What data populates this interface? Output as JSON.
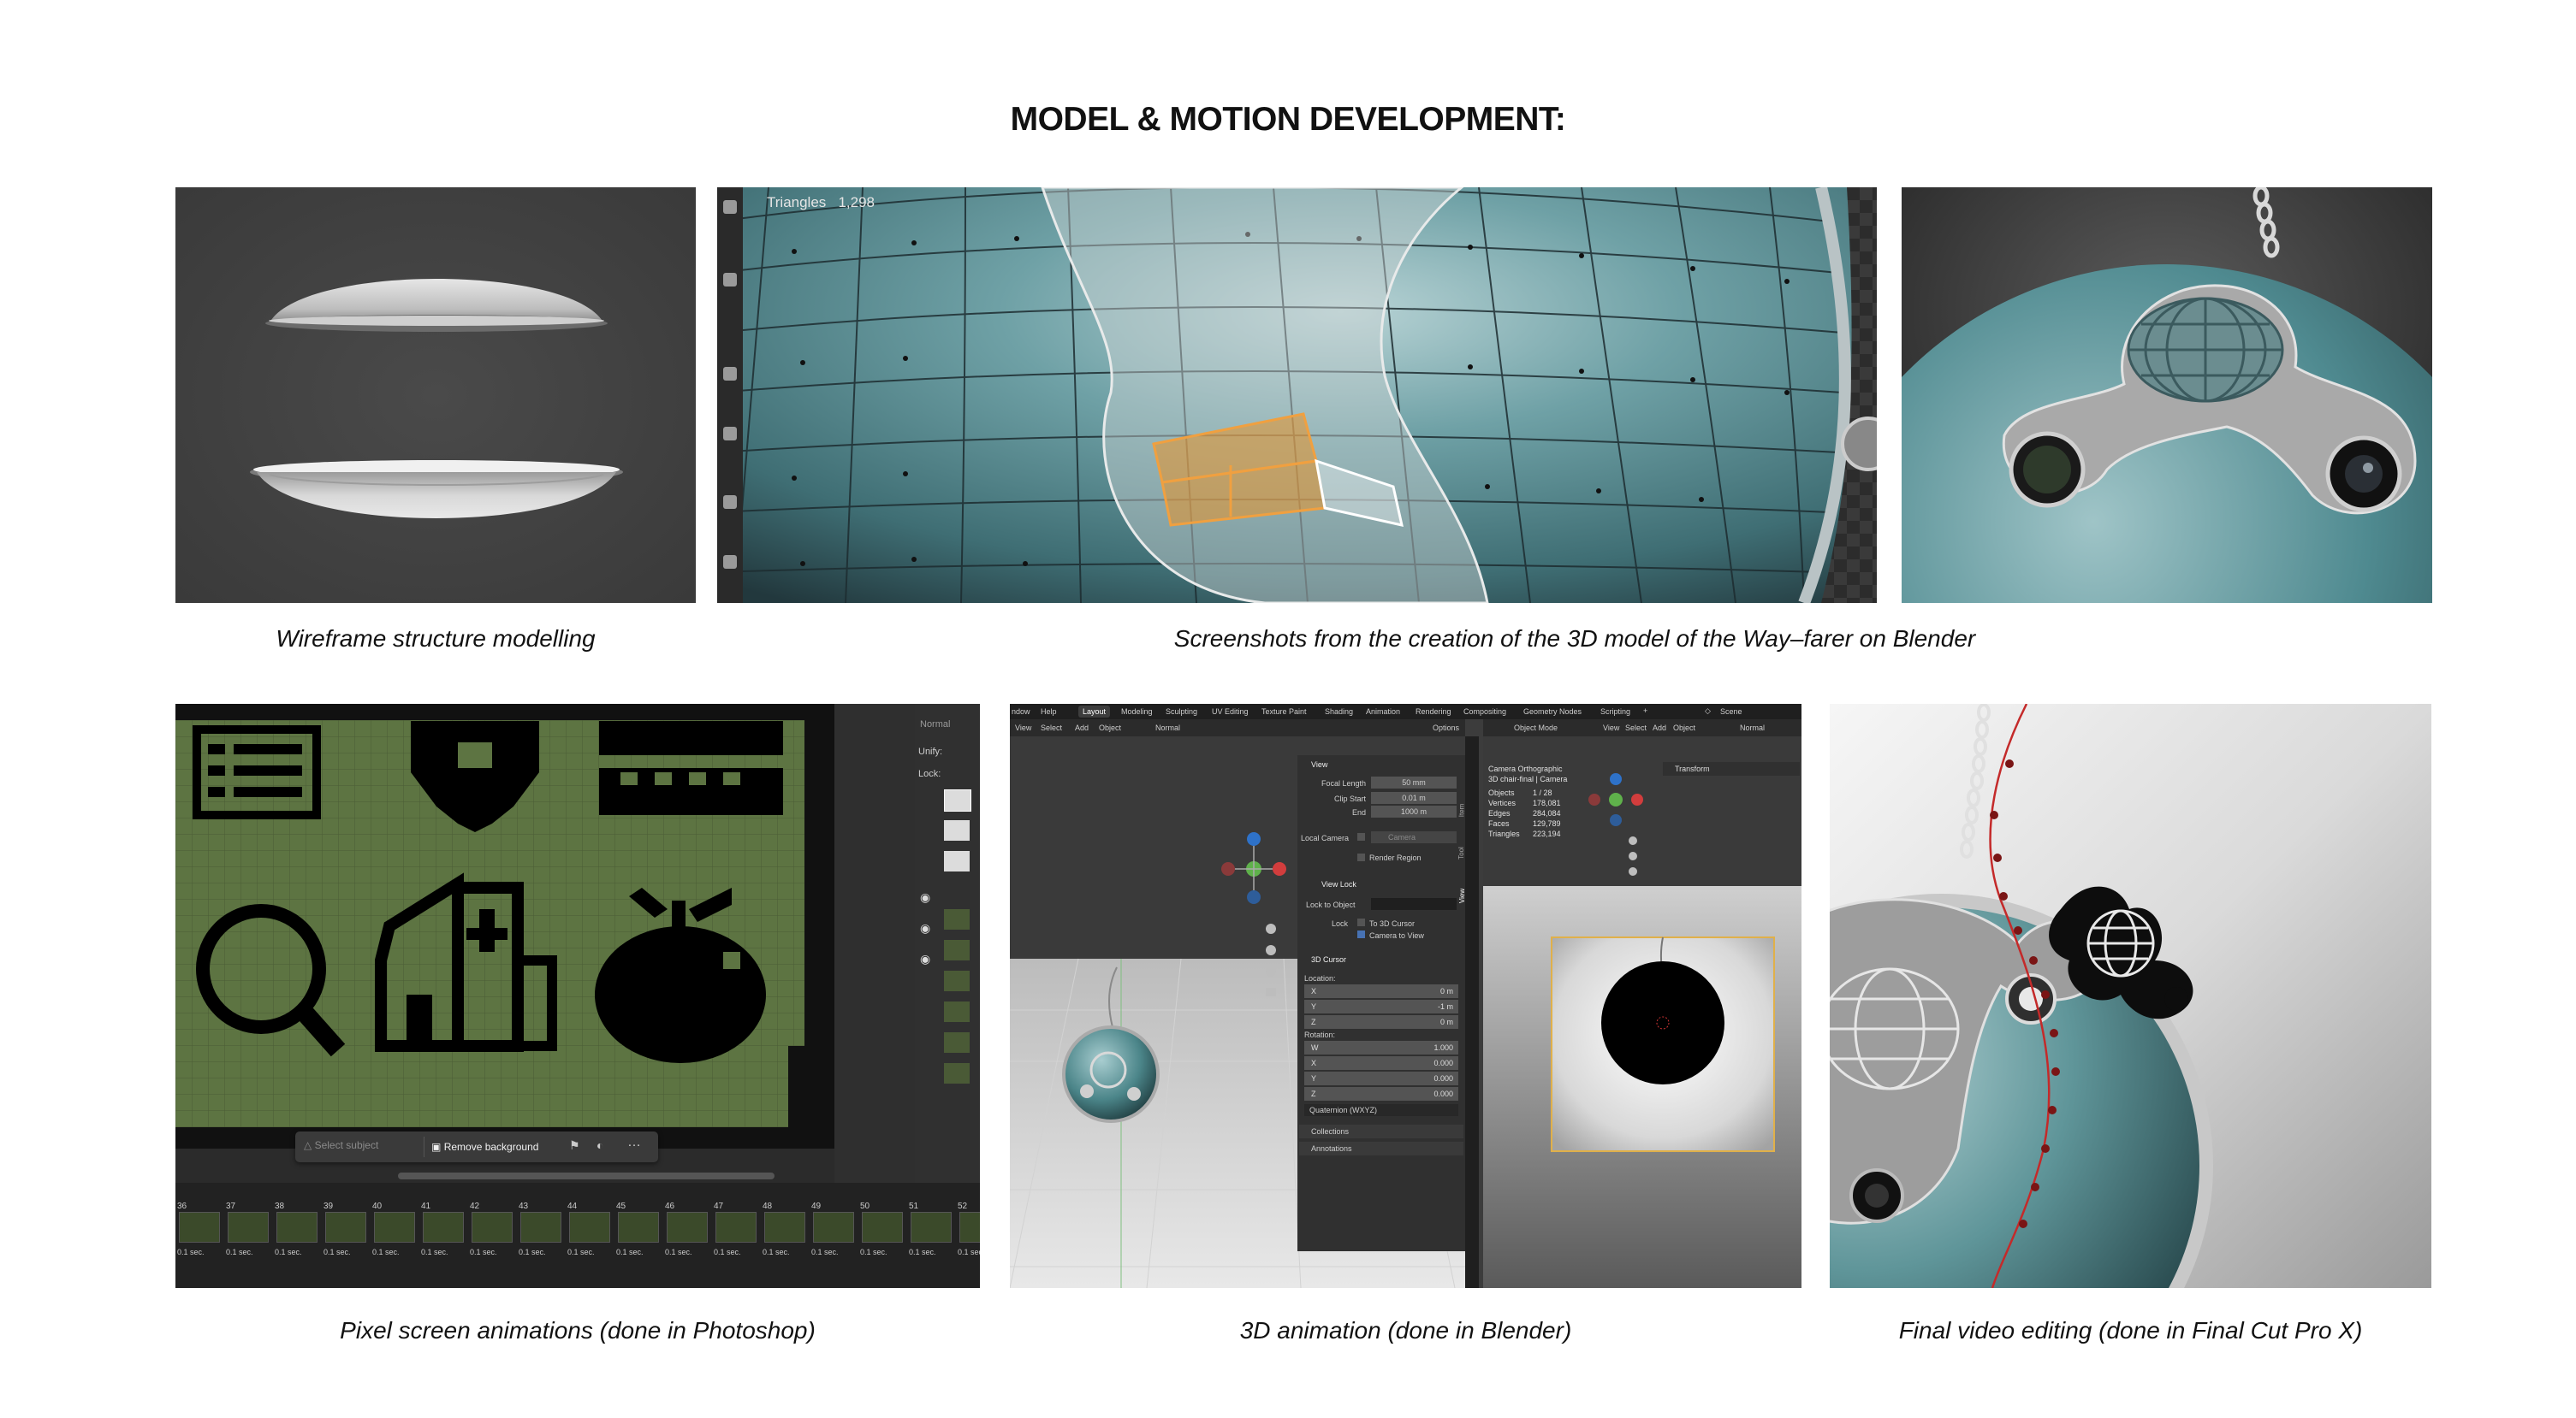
{
  "page": {
    "title": "MODEL & MOTION DEVELOPMENT:"
  },
  "captions": {
    "wireframe": "Wireframe structure modelling",
    "blender_screens": "Screenshots from the creation of the 3D model of the Way–farer on Blender",
    "pixel": "Pixel screen animations (done in Photoshop)",
    "anim3d": "3D animation (done in Blender)",
    "finalcut": "Final video editing (done in Final Cut Pro X)"
  },
  "mesh_panel": {
    "triangles_label": "Triangles",
    "triangles_value": "1,298"
  },
  "photoshop_panel": {
    "unify_label": "Unify:",
    "lock_label": "Lock:",
    "normal_label": "Normal",
    "select_subject": "Select subject",
    "remove_background": "Remove background",
    "frames": [
      "36",
      "37",
      "38",
      "39",
      "40",
      "41",
      "42",
      "43",
      "44",
      "45",
      "46",
      "47",
      "48",
      "49",
      "50",
      "51",
      "52"
    ],
    "frame_delay": "0.1 sec."
  },
  "blender_panel": {
    "menus": [
      "Layout",
      "Modeling",
      "Sculpting",
      "UV Editing",
      "Texture Paint",
      "Shading",
      "Animation",
      "Rendering",
      "Compositing",
      "Geometry Nodes",
      "Scripting"
    ],
    "top_menus": [
      "ndow",
      "Help"
    ],
    "scene_label": "Scene",
    "view_menu": [
      "View",
      "Select",
      "Add",
      "Object"
    ],
    "normal_label": "Normal",
    "object_mode": "Object Mode",
    "options_label": "Options",
    "view_section": "View",
    "focal_length_label": "Focal Length",
    "focal_length": "50 mm",
    "clip_start_label": "Clip Start",
    "clip_start": "0.01 m",
    "end_label": "End",
    "clip_end": "1000 m",
    "local_camera_label": "Local Camera",
    "camera_label": "Camera",
    "render_region_label": "Render Region",
    "view_lock_label": "View Lock",
    "lock_to_object_label": "Lock to Object",
    "lock_label": "Lock",
    "to_3d_cursor_label": "To 3D Cursor",
    "camera_to_view_label": "Camera to View",
    "cursor_section": "3D Cursor",
    "location_label": "Location:",
    "location": [
      {
        "axis": "X",
        "value": "0 m"
      },
      {
        "axis": "Y",
        "value": "-1 m"
      },
      {
        "axis": "Z",
        "value": "0 m"
      }
    ],
    "rotation_label": "Rotation:",
    "rotation": [
      {
        "axis": "W",
        "value": "1.000"
      },
      {
        "axis": "X",
        "value": "0.000"
      },
      {
        "axis": "Y",
        "value": "0.000"
      },
      {
        "axis": "Z",
        "value": "0.000"
      }
    ],
    "rotation_mode": "Quaternion (WXYZ)",
    "collections_label": "Collections",
    "annotations_label": "Annotations",
    "tabs": [
      "Item",
      "Tool",
      "View"
    ],
    "camera_title": "Camera Orthographic",
    "camera_subtitle": "3D chair-final | Camera",
    "stats": [
      {
        "label": "Objects",
        "value": "1 / 28"
      },
      {
        "label": "Vertices",
        "value": "178,081"
      },
      {
        "label": "Edges",
        "value": "284,084"
      },
      {
        "label": "Faces",
        "value": "129,789"
      },
      {
        "label": "Triangles",
        "value": "223,194"
      }
    ],
    "transform_label": "Transform"
  },
  "colors": {
    "teal": "#3f7f86",
    "orange": "#e8932a",
    "pixel_green": "#5d7442",
    "blender_dark": "#2b2b2b",
    "final_red": "#c42a2a"
  }
}
